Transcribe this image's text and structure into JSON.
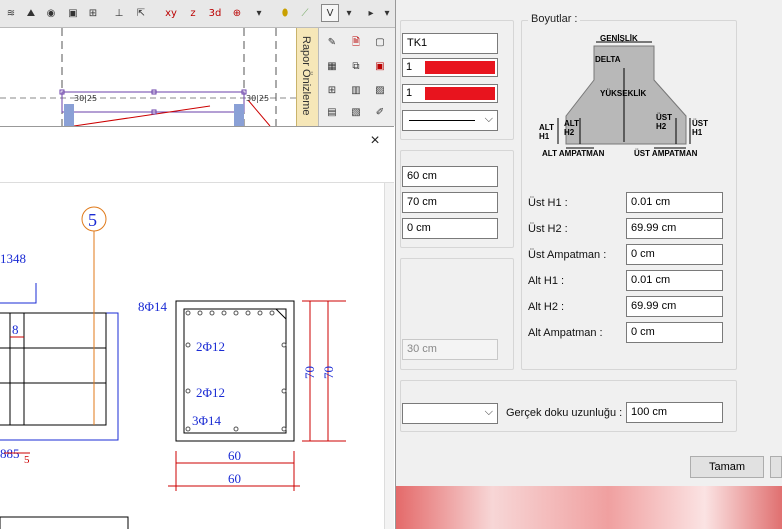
{
  "left": {
    "rapor_label": "Rapor Önizleme",
    "close_label": "×",
    "circle_label": "5",
    "text_1348": "1348",
    "text_8": "8",
    "text_885": "885",
    "text_5": "5",
    "rebar_8": "8Φ14",
    "rebar_2a": "2Φ12",
    "rebar_2b": "2Φ12",
    "rebar_3": "3Φ14",
    "dim_70a": "70",
    "dim_70b": "70",
    "dim_60a": "60",
    "dim_60b": "60",
    "plan_label_1": "30|25",
    "plan_label_2": "30|25"
  },
  "panel": {
    "name_value": "TK1",
    "color1_value": "1",
    "color2_value": "1",
    "dim_60": "60 cm",
    "dim_70": "70 cm",
    "dim_0": "0 cm",
    "disabled_30": "30 cm",
    "boyutlar_title": "Boyutlar :",
    "diagram": {
      "genislik": "GENİŞLİK",
      "delta": "DELTA",
      "yukseklik": "YÜKSEKLİK",
      "alt_h1": "ALT\nH1",
      "alt_h2": "ALT\nH2",
      "ust_h2": "ÜST\nH2",
      "ust_h1": "ÜST\nH1",
      "alt_ampatman": "ALT AMPATMAN",
      "ust_ampatman": "ÜST AMPATMAN"
    },
    "fields": [
      {
        "label": "Üst H1 :",
        "value": "0.01 cm"
      },
      {
        "label": "Üst H2 :",
        "value": "69.99 cm"
      },
      {
        "label": "Üst Ampatman :",
        "value": "0 cm"
      },
      {
        "label": "Alt H1 :",
        "value": "0.01 cm"
      },
      {
        "label": "Alt H2 :",
        "value": "69.99 cm"
      },
      {
        "label": "Alt Ampatman :",
        "value": "0 cm"
      }
    ],
    "texture_label": "Gerçek doku uzunluğu :",
    "texture_value": "100 cm",
    "ok_button": "Tamam"
  },
  "colors": {
    "red": "#e8141e",
    "orange": "#e07a1a",
    "blue": "#1a2bd4"
  }
}
